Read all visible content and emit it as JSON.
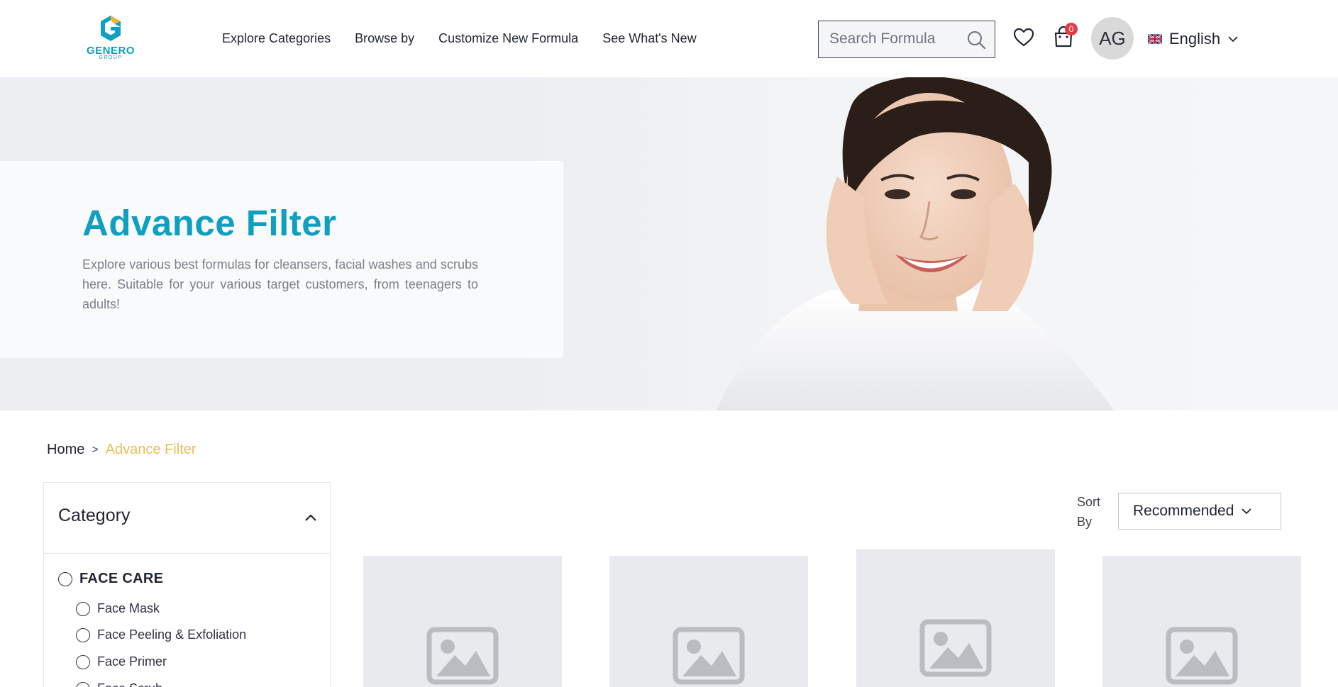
{
  "brand": {
    "name": "GENERO",
    "sub": "GROUP",
    "accent": "#0e9fc1",
    "highlight": "#e8bd54"
  },
  "nav": {
    "items": [
      {
        "label": "Explore Categories"
      },
      {
        "label": "Browse by"
      },
      {
        "label": "Customize New Formula"
      },
      {
        "label": "See What's New"
      }
    ]
  },
  "header": {
    "search_placeholder": "Search Formula",
    "cart_count": "0",
    "avatar_initials": "AG",
    "language": "English"
  },
  "hero": {
    "title": "Advance Filter",
    "description": "Explore various best formulas for cleansers, facial washes and scrubs here. Suitable for your various target customers, from teenagers to adults!"
  },
  "breadcrumb": {
    "home": "Home",
    "separator": ">",
    "current": "Advance Filter"
  },
  "filter": {
    "title": "Category",
    "main_category": "FACE CARE",
    "sub_categories": [
      {
        "label": "Face Mask"
      },
      {
        "label": "Face Peeling & Exfoliation"
      },
      {
        "label": "Face Primer"
      },
      {
        "label": "Face Scrub"
      }
    ]
  },
  "sort": {
    "label": "Sort By",
    "value": "Recommended"
  },
  "products": [
    {
      "image": "image-placeholder-icon"
    },
    {
      "image": "image-placeholder-icon"
    },
    {
      "image": "image-placeholder-icon"
    },
    {
      "image": "image-placeholder-icon"
    }
  ]
}
